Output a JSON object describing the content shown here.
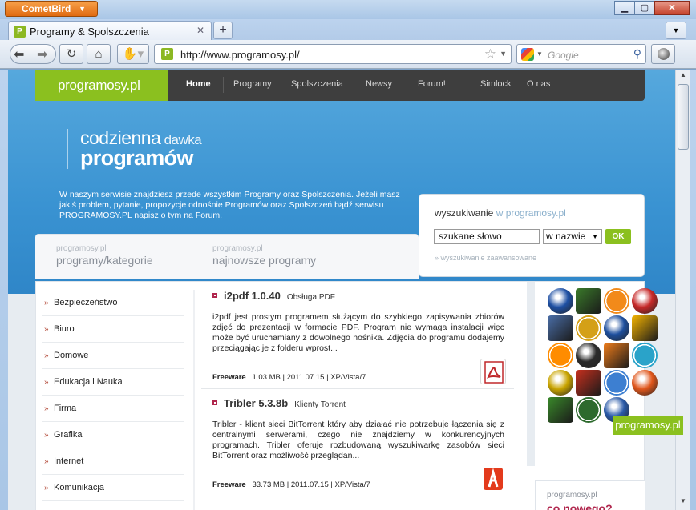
{
  "browser": {
    "app_menu_label": "CometBird",
    "tab_title": "Programy & Spolszczenia",
    "url": "http://www.programosy.pl/",
    "search_placeholder": "Google",
    "favicon_letter": "P"
  },
  "site": {
    "logo": "programosy.pl",
    "nav": [
      "Home",
      "Programy",
      "Spolszczenia",
      "Newsy",
      "Forum!",
      "Simlock",
      "O nas"
    ],
    "tagline_part1": "codzienna",
    "tagline_part2": " dawka",
    "tagline_line2": "programów",
    "intro": "W naszym serwisie znajdziesz przede wszystkim Programy oraz Spolszczenia. Jeżeli masz jakiś problem, pytanie, propozycje odnośnie Programów oraz Spolszczeń bądź serwisu PROGRAMOSY.PL napisz o tym na Forum.",
    "search": {
      "title": "wyszukiwanie",
      "title_light": " w programosy.pl",
      "input_value": "szukane słowo",
      "select_value": "w nazwie",
      "ok_label": "OK",
      "advanced_link": "» wyszukiwanie zaawansowane"
    },
    "cat_tabs": [
      {
        "small": "programosy.pl",
        "big": "programy/kategorie"
      },
      {
        "small": "programosy.pl",
        "big": "najnowsze programy"
      }
    ],
    "categories": [
      "Bezpieczeństwo",
      "Biuro",
      "Domowe",
      "Edukacja i Nauka",
      "Firma",
      "Grafika",
      "Internet",
      "Komunikacja"
    ],
    "programs": [
      {
        "name": "i2pdf 1.0.40",
        "category": "Obsługa PDF",
        "description": "i2pdf jest prostym programem służącym do szybkiego zapisywania zbiorów zdjęć do prezentacji w formacie PDF. Program nie wymaga instalacji więc może być uruchamiany z dowolnego nośnika. Zdjęcia do programu dodajemy przeciągając je z folderu wprost...",
        "license": "Freeware",
        "meta": " | 1.03 MB | 2011.07.15 | XP/Vista/7",
        "icon": "pdf-icon"
      },
      {
        "name": "Tribler 5.3.8b",
        "category": "Klienty Torrent",
        "description": "Tribler - klient sieci BitTorrent który aby działać nie potrzebuje łączenia się z centralnymi serwerami, czego nie znajdziemy w konkurencyjnych programach. Tribler oferuje rozbudowaną wyszukiwarkę zasobów sieci BitTorrent oraz możliwość przeglądan...",
        "license": "Freeware",
        "meta": " | 33.73 MB | 2011.07.15 | XP/Vista/7",
        "icon": "tribler-icon"
      }
    ],
    "app_icons": [
      {
        "name": "aimp-icon",
        "color": "#1d4fa3"
      },
      {
        "name": "film-strip-icon",
        "color": "#3a7a2a"
      },
      {
        "name": "vlc-icon",
        "color": "#f28a1a"
      },
      {
        "name": "shield-icon",
        "color": "#c62828"
      },
      {
        "name": "photo-icon",
        "color": "#4a6ea8"
      },
      {
        "name": "clapper-icon",
        "color": "#d4a017"
      },
      {
        "name": "real-player-icon",
        "color": "#1e4f9e"
      },
      {
        "name": "thunder-icon",
        "color": "#f5b400"
      },
      {
        "name": "winamp-icon",
        "color": "#ff8c00"
      },
      {
        "name": "fox-icon",
        "color": "#2b2b2b"
      },
      {
        "name": "avast-icon",
        "color": "#f07d1a"
      },
      {
        "name": "disc-icon",
        "color": "#2aa3c9"
      },
      {
        "name": "stethoscope-icon",
        "color": "#c9a400"
      },
      {
        "name": "burn-icon",
        "color": "#c7301e"
      },
      {
        "name": "cloud-icon",
        "color": "#3d7fd1"
      },
      {
        "name": "nero-icon",
        "color": "#e0561b"
      },
      {
        "name": "globe-icon",
        "color": "#3a8a2a"
      },
      {
        "name": "spreadsheet-icon",
        "color": "#2d6a2d"
      },
      {
        "name": "defender-icon",
        "color": "#2a5aa8"
      }
    ],
    "promo_small": "programosy.pl",
    "promo_big": "co nowego?",
    "promo_badge": "programosy.pl"
  }
}
